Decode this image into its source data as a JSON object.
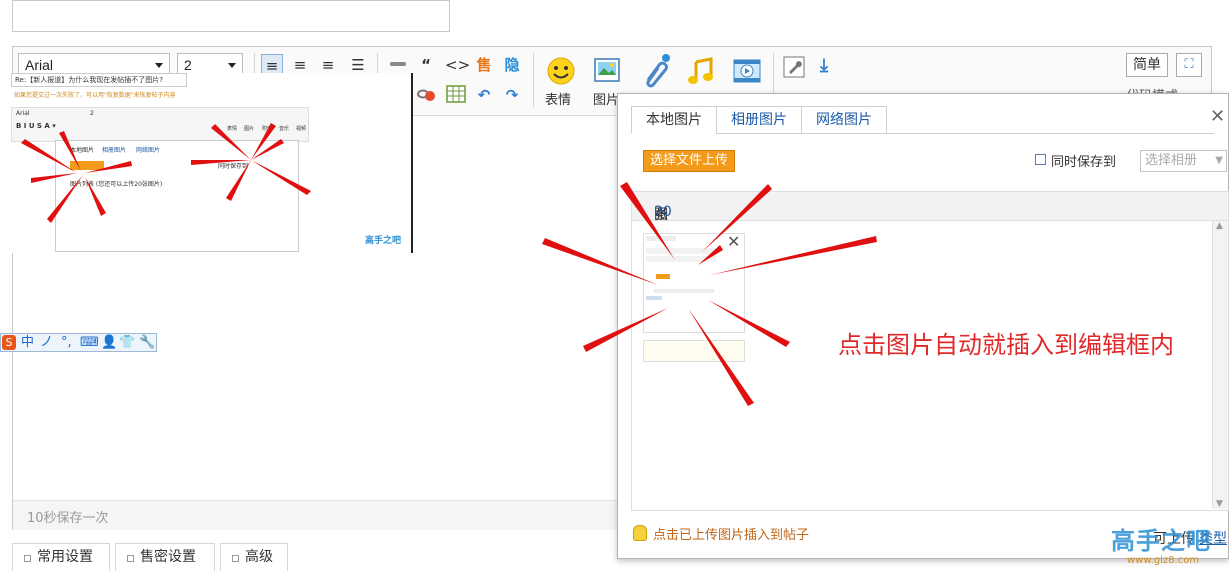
{
  "editor": {
    "font_name": "Arial",
    "font_size": "2",
    "emoji_label": "表情",
    "image_label": "图片",
    "simple_button": "简单",
    "partial_text": "代码模式",
    "autosave": "10秒保存一次",
    "ime_chars": [
      "中",
      "ノ",
      "°,",
      "⌨",
      "👤",
      "👕",
      "🔧"
    ]
  },
  "bottom_tabs": [
    "常用设置",
    "售密设置",
    "高级"
  ],
  "dialog": {
    "tabs": [
      "本地图片",
      "相册图片",
      "网络图片"
    ],
    "upload_button": "选择文件上传",
    "sync_label": "同时保存到",
    "album_placeholder": "选择相册",
    "list_prefix": "图片列表 (您还可以上传",
    "list_count": "20",
    "list_suffix": "张图片)",
    "hint": "点击已上传图片插入到帖子",
    "footer_partial": "可上传",
    "footer_link": "类型"
  },
  "embedded": {
    "title": "Re:【新人报道】为什么我现在发帖插不了图片?",
    "notice": "如果您提交过一次失败了，可以用\"恢复数据\"来恢复帖子内容",
    "font": "Arial",
    "size": "2",
    "tabs": [
      "本地图片",
      "相册图片",
      "网络图片"
    ],
    "sync": "同时保存到",
    "list": "图片列表 (您还可以上传20张图片)",
    "labels": [
      "表情",
      "图片",
      "附件",
      "音乐",
      "视频"
    ]
  },
  "annotation": "点击图片自动就插入到编辑框内",
  "watermark": {
    "text": "高手之吧",
    "url": "www.glz8.com"
  },
  "colors": {
    "accent_orange": "#f49a1a",
    "annotation_red": "#e02a2a",
    "link_blue": "#1d5aa8"
  }
}
